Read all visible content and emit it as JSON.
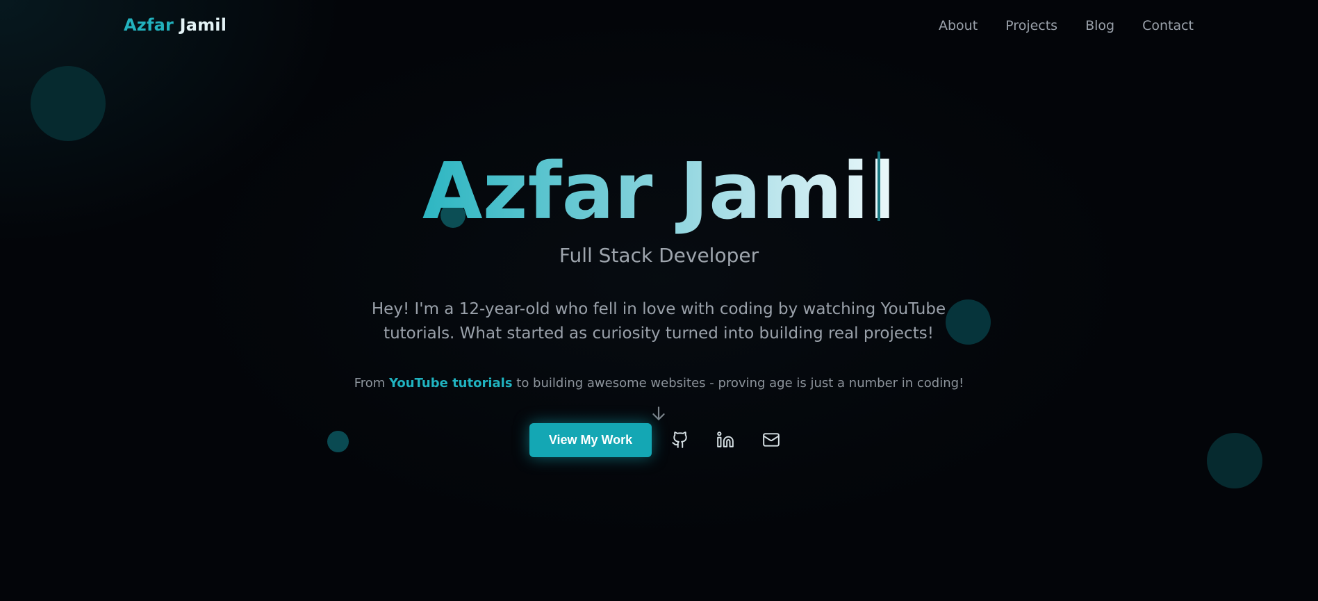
{
  "header": {
    "logo_first": "Azfar",
    "logo_last": "Jamil",
    "nav": [
      {
        "label": "About"
      },
      {
        "label": "Projects"
      },
      {
        "label": "Blog"
      },
      {
        "label": "Contact"
      }
    ]
  },
  "hero": {
    "title": "Azfar Jamil",
    "subtitle": "Full Stack Developer",
    "bio": "Hey! I'm a 12-year-old who fell in love with coding by watching YouTube tutorials. What started as curiosity turned into building real projects!",
    "tagline_before": "From ",
    "tagline_highlight": "YouTube tutorials",
    "tagline_after": " to building awesome websites - proving age is just a number in coding!",
    "cta_label": "View My Work"
  },
  "social": [
    {
      "icon": "github-icon"
    },
    {
      "icon": "linkedin-icon"
    },
    {
      "icon": "mail-icon"
    }
  ],
  "colors": {
    "accent": "#14a7b4",
    "background": "#030509",
    "text_muted": "#9aa1aa"
  }
}
